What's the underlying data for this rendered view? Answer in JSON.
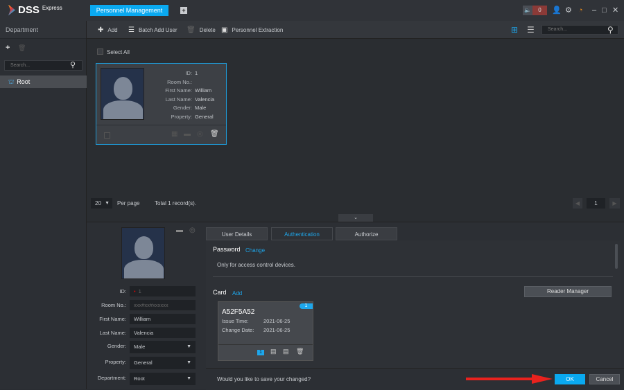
{
  "app": {
    "brand": "DSS",
    "edition": "Express",
    "tab": "Personnel Management",
    "alarm_count": "0"
  },
  "sidebar": {
    "title": "Department",
    "search_placeholder": "Search...",
    "root": "Root"
  },
  "toolbar": {
    "add": "Add",
    "batch_add": "Batch Add User",
    "delete": "Delete",
    "extraction": "Personnel Extraction",
    "search_placeholder": "Search..."
  },
  "list": {
    "select_all": "Select All",
    "card": {
      "fields": [
        {
          "k": "ID:",
          "v": "1"
        },
        {
          "k": "Room No.:",
          "v": ""
        },
        {
          "k": "First Name:",
          "v": "William"
        },
        {
          "k": "Last Name:",
          "v": "Valencia"
        },
        {
          "k": "Gender:",
          "v": "Male"
        },
        {
          "k": "Property:",
          "v": "General"
        }
      ]
    },
    "page_size": "20",
    "per_page": "Per page",
    "total": "Total 1 record(s).",
    "page": "1"
  },
  "detail": {
    "form": [
      {
        "k": "ID:",
        "v": "1"
      },
      {
        "k": "Room No.:",
        "v": "xxx#xx#xxxxxx"
      },
      {
        "k": "First Name:",
        "v": "William"
      },
      {
        "k": "Last Name:",
        "v": "Valencia"
      },
      {
        "k": "Gender:",
        "v": "Male"
      },
      {
        "k": "Property:",
        "v": "General"
      },
      {
        "k": "Department:",
        "v": "Root"
      }
    ],
    "tabs": [
      "User Details",
      "Authentication",
      "Authorize"
    ],
    "active_tab": "Authentication",
    "password_label": "Password",
    "change": "Change",
    "note": "Only for access control devices.",
    "card_label": "Card",
    "add": "Add",
    "reader_manager": "Reader Manager",
    "card": {
      "number": "A52F5A52",
      "badge": "1",
      "issue_label": "Issue Time:",
      "issue": "2021-06-25",
      "change_label": "Change Date:",
      "change": "2021-06-25",
      "index": "1"
    },
    "prompt": "Would you like to save your changed?",
    "ok": "OK",
    "cancel": "Cancel"
  },
  "colors": {
    "accent": "#0aa9f0",
    "arrow": "#e8221e"
  }
}
